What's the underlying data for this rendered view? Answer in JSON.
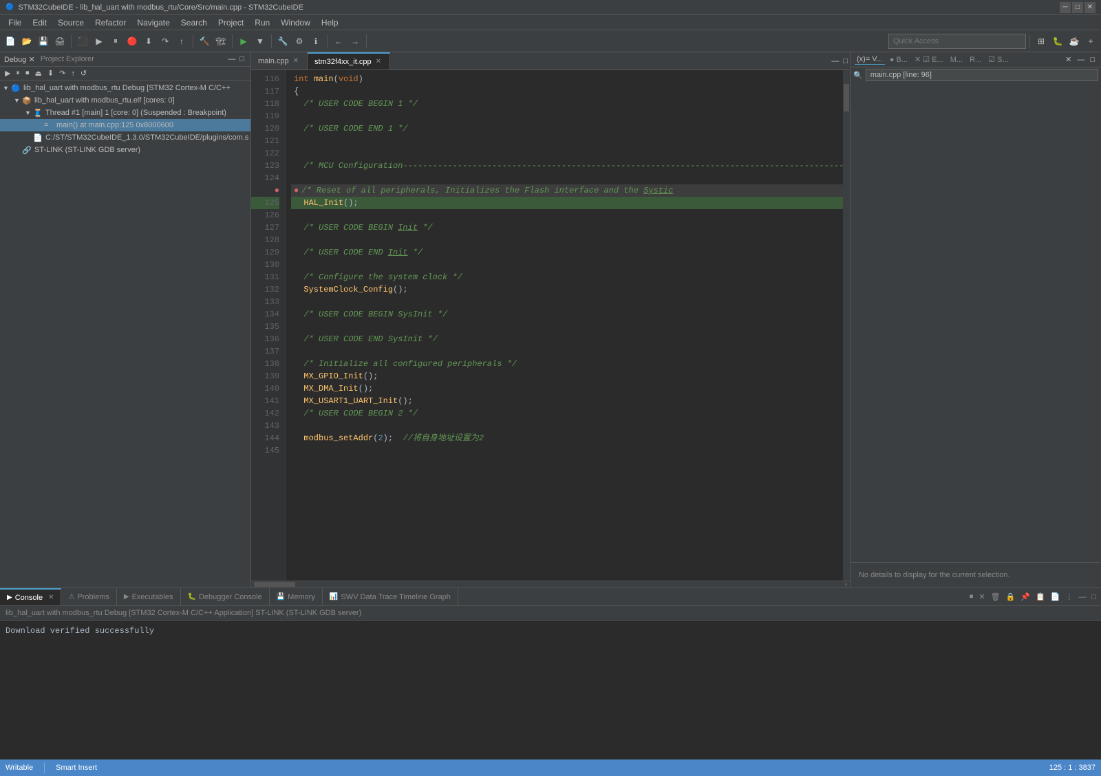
{
  "titleBar": {
    "icon": "🔵",
    "title": "STM32CubeIDE - lib_hal_uart with modbus_rtu/Core/Src/main.cpp - STM32CubeIDE",
    "minimize": "─",
    "maximize": "□",
    "close": "✕"
  },
  "menuBar": {
    "items": [
      "File",
      "Edit",
      "Source",
      "Refactor",
      "Navigate",
      "Search",
      "Project",
      "Run",
      "Window",
      "Help"
    ]
  },
  "toolbar": {
    "quickAccessPlaceholder": "Quick Access"
  },
  "leftPanel": {
    "title": "Debug ✕",
    "explorerTitle": "Project Explorer",
    "tree": [
      {
        "indent": 0,
        "arrow": "▼",
        "icon": "🔵",
        "label": "lib_hal_uart with modbus_rtu Debug [STM32 Cortex-M C/C++",
        "level": 0
      },
      {
        "indent": 1,
        "arrow": "▼",
        "icon": "📦",
        "label": "lib_hal_uart with modbus_rtu.elf [cores: 0]",
        "level": 1
      },
      {
        "indent": 2,
        "arrow": "▼",
        "icon": "🧵",
        "label": "Thread #1 [main] 1 [core: 0] (Suspended : Breakpoint)",
        "level": 2
      },
      {
        "indent": 3,
        "arrow": "",
        "icon": "📍",
        "label": "main() at main.cpp:125 0x8000600",
        "level": 3,
        "selected": true
      },
      {
        "indent": 2,
        "arrow": "",
        "icon": "📄",
        "label": "C:/ST/STM32CubeIDE_1.3.0/STM32CubeIDE/plugins/com.s",
        "level": 2
      },
      {
        "indent": 1,
        "arrow": "",
        "icon": "🔗",
        "label": "ST-LINK (ST-LINK GDB server)",
        "level": 1
      }
    ]
  },
  "editorTabs": [
    {
      "label": "main.cpp",
      "active": false
    },
    {
      "label": "stm32f4xx_it.cpp",
      "active": true
    }
  ],
  "codeLines": [
    {
      "num": 116,
      "content": "int main(void)",
      "type": "normal",
      "kw": true
    },
    {
      "num": 117,
      "content": "{",
      "type": "normal"
    },
    {
      "num": 118,
      "content": "  /* USER CODE BEGIN 1 */",
      "type": "comment"
    },
    {
      "num": 119,
      "content": "",
      "type": "normal"
    },
    {
      "num": 120,
      "content": "  /* USER CODE END 1 */",
      "type": "comment"
    },
    {
      "num": 121,
      "content": "",
      "type": "normal"
    },
    {
      "num": 122,
      "content": "",
      "type": "normal"
    },
    {
      "num": 123,
      "content": "  /* MCU Configuration--------------------------------------------",
      "type": "comment"
    },
    {
      "num": 124,
      "content": "",
      "type": "normal"
    },
    {
      "num": 125,
      "content": "  /* Reset of all peripherals, Initializes the Flash interface and the Systic",
      "type": "comment",
      "breakpoint": true
    },
    {
      "num": 126,
      "content": "  HAL_Init();",
      "type": "code",
      "highlighted": true
    },
    {
      "num": 127,
      "content": "",
      "type": "normal"
    },
    {
      "num": 128,
      "content": "  /* USER CODE BEGIN Init */",
      "type": "comment"
    },
    {
      "num": 129,
      "content": "",
      "type": "normal"
    },
    {
      "num": 130,
      "content": "  /* USER CODE END Init */",
      "type": "comment"
    },
    {
      "num": 131,
      "content": "",
      "type": "normal"
    },
    {
      "num": 132,
      "content": "  /* Configure the system clock */",
      "type": "comment"
    },
    {
      "num": 133,
      "content": "  SystemClock_Config();",
      "type": "code"
    },
    {
      "num": 134,
      "content": "",
      "type": "normal"
    },
    {
      "num": 135,
      "content": "  /* USER CODE BEGIN SysInit */",
      "type": "comment"
    },
    {
      "num": 136,
      "content": "",
      "type": "normal"
    },
    {
      "num": 137,
      "content": "  /* USER CODE END SysInit */",
      "type": "comment"
    },
    {
      "num": 138,
      "content": "",
      "type": "normal"
    },
    {
      "num": 139,
      "content": "  /* Initialize all configured peripherals */",
      "type": "comment"
    },
    {
      "num": 140,
      "content": "  MX_GPIO_Init();",
      "type": "code"
    },
    {
      "num": 141,
      "content": "  MX_DMA_Init();",
      "type": "code"
    },
    {
      "num": 142,
      "content": "  MX_USART1_UART_Init();",
      "type": "code"
    },
    {
      "num": 143,
      "content": "  /* USER CODE BEGIN 2 */",
      "type": "comment"
    },
    {
      "num": 144,
      "content": "",
      "type": "normal"
    },
    {
      "num": 145,
      "content": "  modbus_setAddr(2);  //将自身地址设置为2",
      "type": "code"
    }
  ],
  "rightPanel": {
    "tabs": [
      "(x)= V...",
      "●  B...",
      "✕ ☑ E...",
      "M...",
      "R...",
      "☑ S...",
      ""
    ],
    "outlineSearch": "main.cpp [line: 96]",
    "noDetails": "No details to display for the current selection."
  },
  "bottomTabs": [
    {
      "icon": "▶",
      "label": "Console",
      "active": true
    },
    {
      "icon": "",
      "label": "Problems"
    },
    {
      "icon": "▶",
      "label": "Executables"
    },
    {
      "icon": "🐛",
      "label": "Debugger Console"
    },
    {
      "icon": "💾",
      "label": "Memory"
    },
    {
      "icon": "📊",
      "label": "SWV Data Trace Timeline Graph"
    }
  ],
  "consoleHeader": "lib_hal_uart with modbus_rtu Debug [STM32 Cortex-M C/C++ Application] ST-LINK (ST-LINK GDB server)",
  "consoleOutput": "Download verified successfully",
  "statusBar": {
    "writable": "Writable",
    "insertMode": "Smart Insert",
    "position": "125 : 1 : 3837"
  }
}
